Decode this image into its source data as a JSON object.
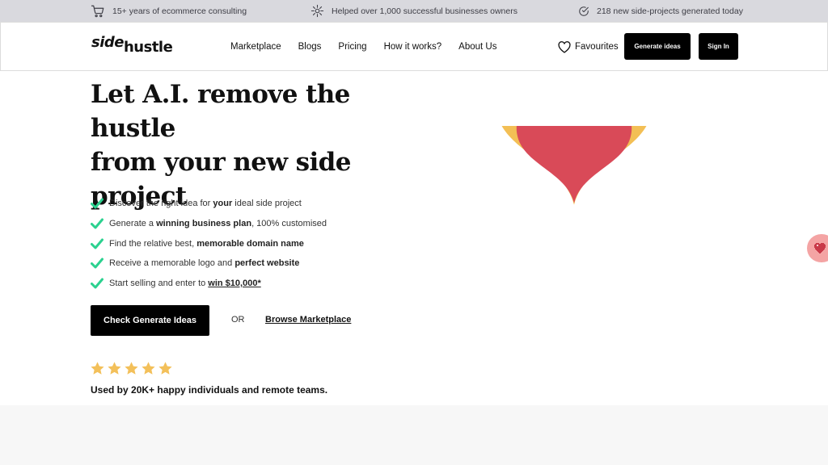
{
  "topbar": {
    "items": [
      {
        "icon": "cart-icon",
        "text": "15+ years of ecommerce consulting"
      },
      {
        "icon": "sparkle-icon",
        "text": "Helped over 1,000 successful businesses owners"
      },
      {
        "icon": "check-circle-icon",
        "text": "218 new side-projects generated today"
      }
    ]
  },
  "nav": {
    "logo_part1": "side",
    "logo_part2": "hustle",
    "links": [
      "Marketplace",
      "Blogs",
      "Pricing",
      "How it works?",
      "About Us"
    ],
    "favourites_label": "Favourites",
    "generate_label": "Generate ideas",
    "signin_label": "Sign In"
  },
  "hero": {
    "title_lines": [
      "Let A.I. remove the hustle",
      "from your new side",
      "project"
    ],
    "features": [
      {
        "pre": "Discover the right idea for ",
        "bold": "your",
        "post": " ideal side project"
      },
      {
        "pre": "Generate a ",
        "bold": "winning business plan",
        "post": ", 100% customised"
      },
      {
        "pre": "Find the relative best, ",
        "bold": "memorable domain name",
        "post": ""
      },
      {
        "pre": "Receive a memorable logo and ",
        "bold": "perfect website",
        "post": ""
      },
      {
        "pre": "Start selling and enter to ",
        "link": "win $10,000*",
        "post": ""
      }
    ],
    "cta_label": "Check Generate Ideas",
    "or_label": "OR",
    "browse_label": "Browse Marketplace",
    "rating": 5,
    "social_proof": "Used by 20K+ happy individuals and remote teams."
  },
  "colors": {
    "check": "#2bd18f",
    "star": "#f3c05a",
    "heart_outer": "#2e86a6",
    "heart_middle": "#f3bf55",
    "heart_inner": "#d94a58",
    "topbar_bg": "#d9d9de",
    "button_bg": "#000000"
  }
}
